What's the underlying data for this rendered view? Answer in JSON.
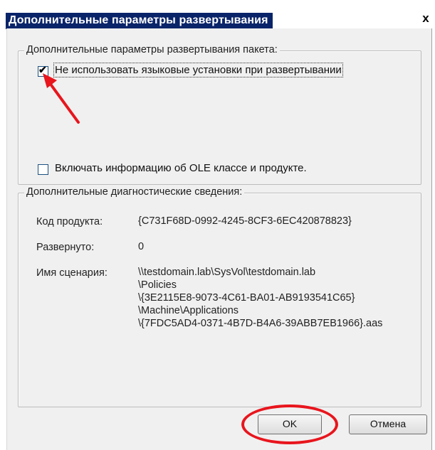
{
  "dialog": {
    "title": "Дополнительные параметры развертывания",
    "close_glyph": "x"
  },
  "deploy_group": {
    "legend": "Дополнительные параметры развертывания пакета:",
    "checkbox_ignore_language": {
      "label": "Не использовать языковые установки при развертывании",
      "checked": true
    },
    "checkbox_ole_info": {
      "label": "Включать информацию об OLE классе и продукте.",
      "checked": false
    }
  },
  "diag_group": {
    "legend": "Дополнительные диагностические сведения:",
    "product_code_label": "Код продукта:",
    "product_code_value": "{C731F68D-0992-4245-8CF3-6EC420878823}",
    "deployed_label": "Развернуто:",
    "deployed_value": "0",
    "script_name_label": "Имя сценария:",
    "script_name_lines": [
      "\\\\testdomain.lab\\SysVol\\testdomain.lab",
      "\\Policies",
      "\\{3E2115E8-9073-4C61-BA01-AB9193541C65}",
      "\\Machine\\Applications",
      "\\{7FDC5AD4-0371-4B7D-B4A6-39ABB7EB1966}.aas"
    ]
  },
  "buttons": {
    "ok_label": "OK",
    "cancel_label": "Отмена"
  },
  "annotations": {
    "arrow_color": "#e8151d",
    "ring_color": "#e8151d"
  }
}
